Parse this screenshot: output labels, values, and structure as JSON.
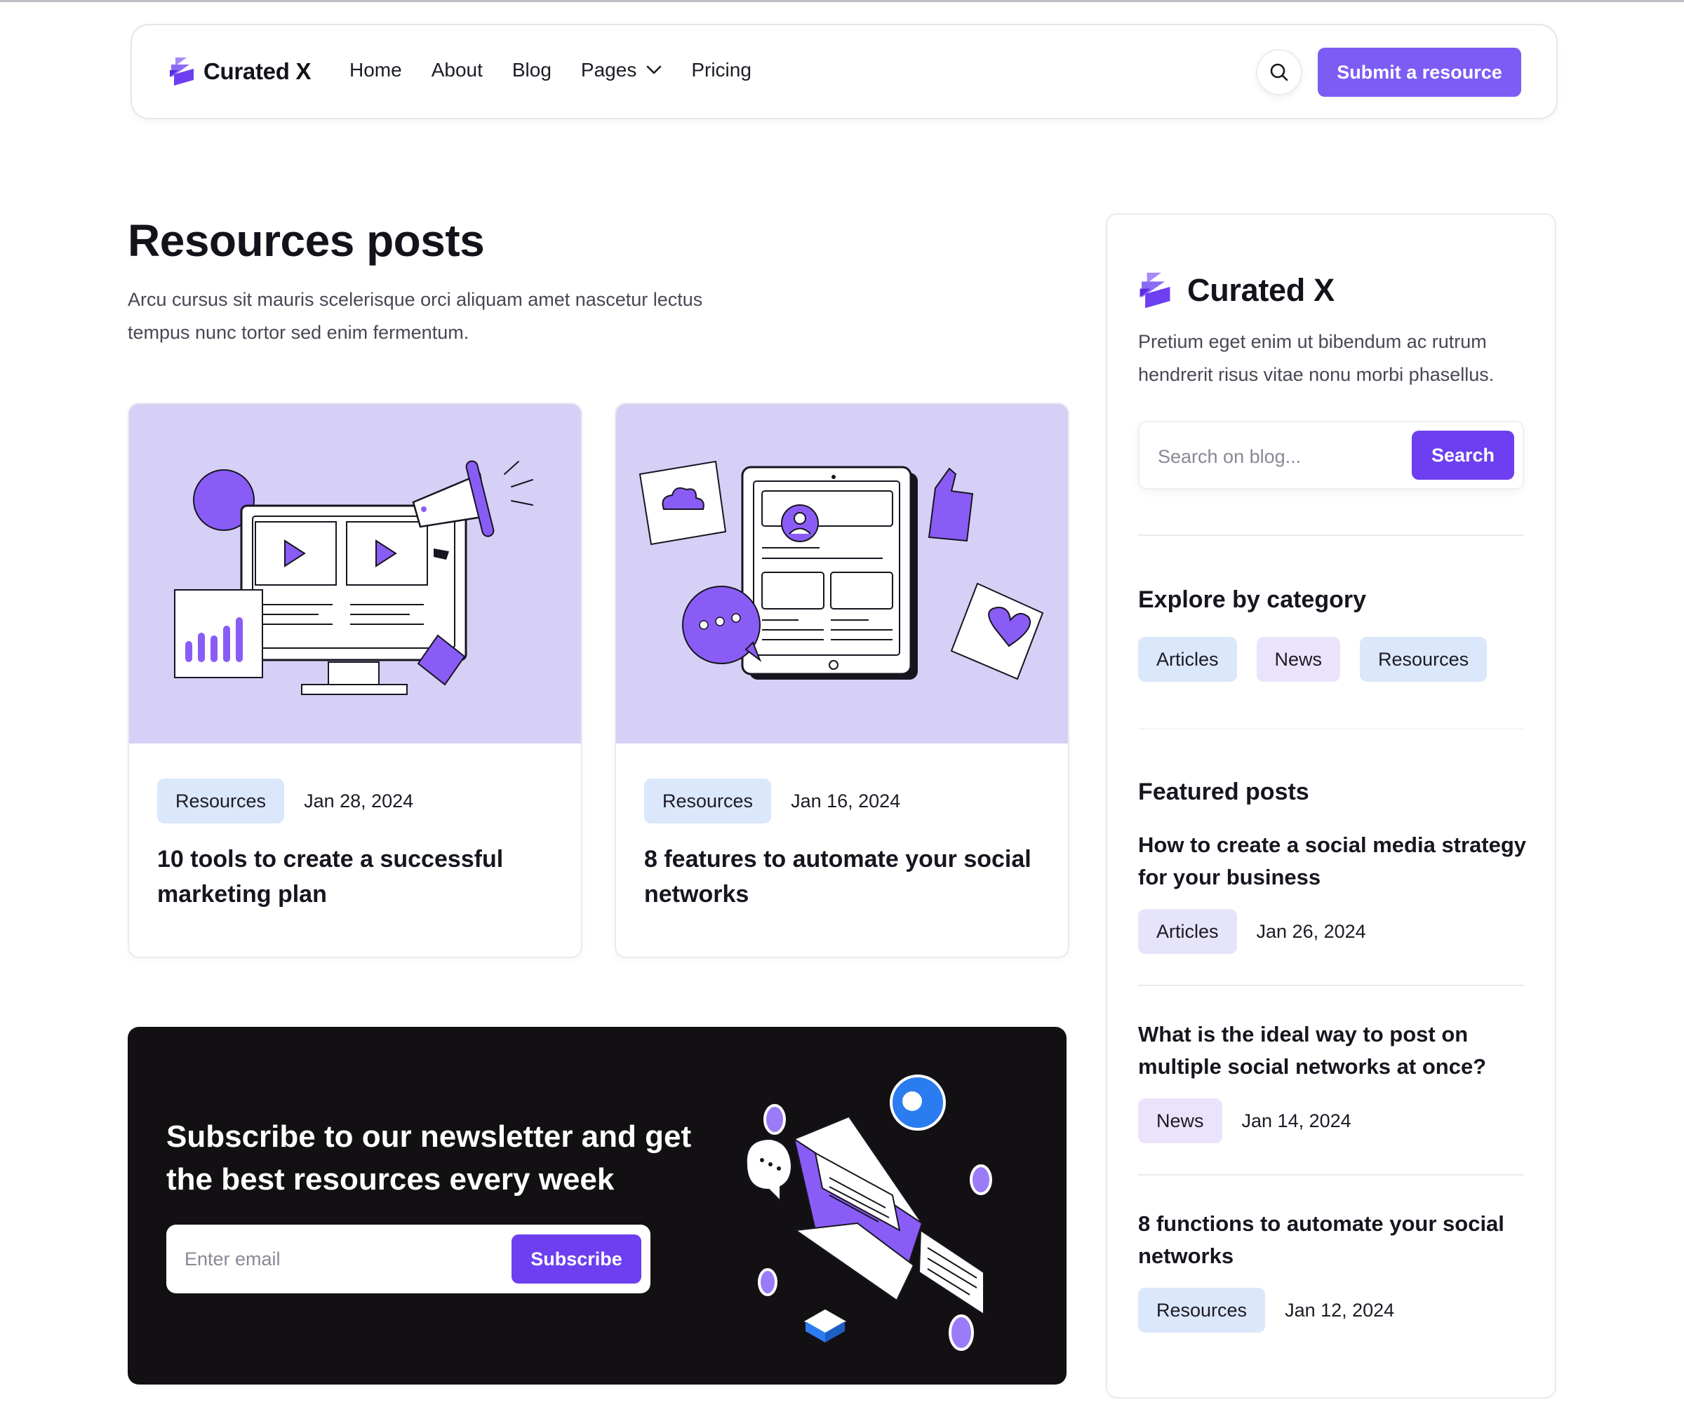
{
  "brand": {
    "name": "Curated X",
    "accent": "#7c5cf5",
    "button_dark": "#6d3ff0"
  },
  "nav": {
    "items": [
      "Home",
      "About",
      "Blog",
      "Pages",
      "Pricing"
    ],
    "pages_icon": "chevron-down-icon",
    "search_icon": "search-icon",
    "submit_label": "Submit a resource"
  },
  "main": {
    "title": "Resources posts",
    "subtitle": "Arcu  cursus sit mauris scelerisque orci aliquam amet nascetur lectus tempus nunc tortor sed enim fermentum."
  },
  "posts": [
    {
      "category": "Resources",
      "date": "Jan 28, 2024",
      "title": "10 tools to create a successful marketing plan",
      "image": "marketing-illustration"
    },
    {
      "category": "Resources",
      "date": "Jan 16, 2024",
      "title": "8 features to automate your social networks",
      "image": "social-illustration"
    }
  ],
  "newsletter": {
    "title": "Subscribe to our newsletter and get the best resources every week",
    "email_placeholder": "Enter email",
    "subscribe_label": "Subscribe",
    "image": "envelope-illustration"
  },
  "sidebar": {
    "brand": "Curated X",
    "description": "Pretium eget enim ut bibendum ac rutrum hendrerit risus vitae nonu morbi phasellus.",
    "search_placeholder": "Search on blog...",
    "search_label": "Search",
    "categories_heading": "Explore by category",
    "categories": [
      "Articles",
      "News",
      "Resources"
    ],
    "featured_heading": "Featured posts",
    "featured": [
      {
        "title": "How to create a social media strategy for your business",
        "category": "Articles",
        "date": "Jan 26, 2024"
      },
      {
        "title": "What is the ideal way to post on multiple social networks at once?",
        "category": "News",
        "date": "Jan 14, 2024"
      },
      {
        "title": "8 functions to automate your social networks",
        "category": "Resources",
        "date": "Jan 12, 2024"
      }
    ]
  }
}
